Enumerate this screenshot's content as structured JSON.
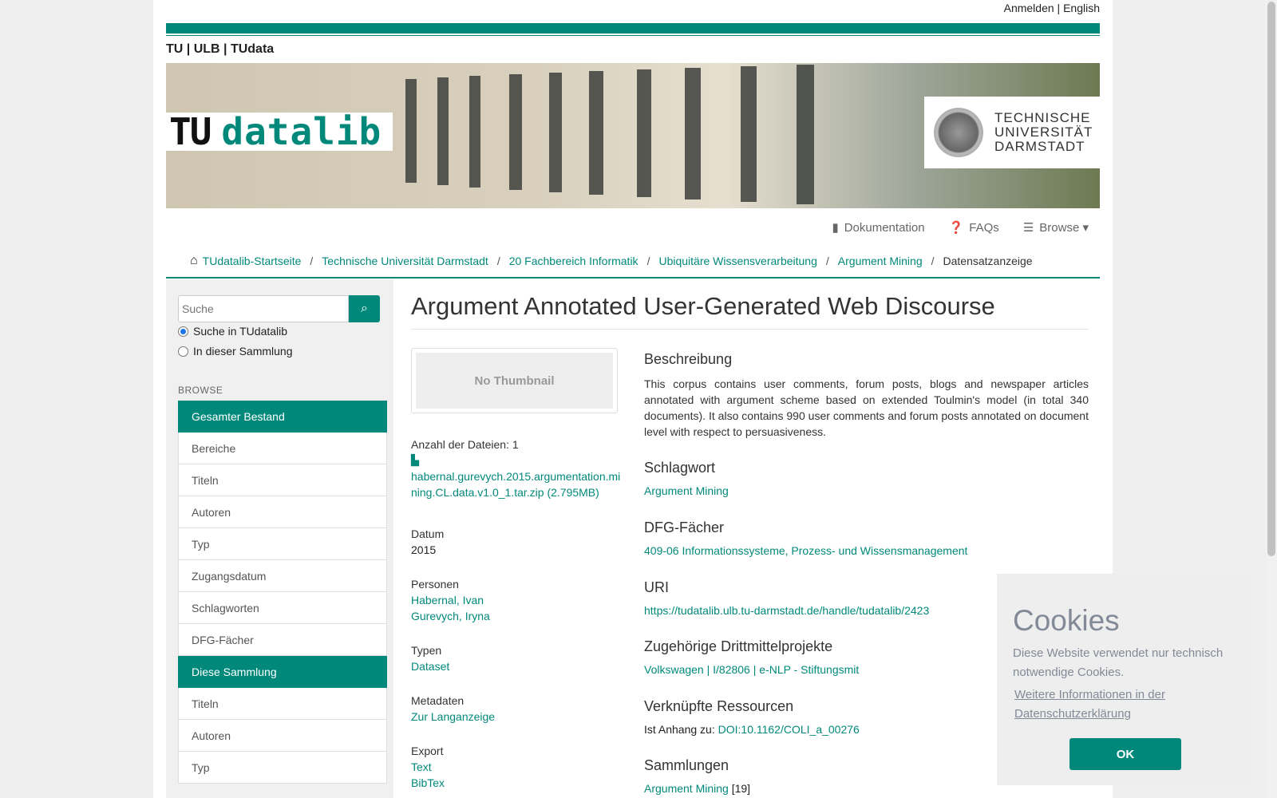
{
  "header": {
    "login": "Anmelden",
    "sep": "|",
    "language": "English",
    "brand": "TU | ULB | TUdata"
  },
  "banner": {
    "logo_tu": "TU",
    "logo_datalib": "datalib",
    "tud_line1": "TECHNISCHE",
    "tud_line2": "UNIVERSITÄT",
    "tud_line3": "DARMSTADT"
  },
  "nav": {
    "docs": "Dokumentation",
    "faqs": "FAQs",
    "browse": "Browse"
  },
  "breadcrumb": [
    "TUdatalib-Startseite",
    "Technische Universität Darmstadt",
    "20 Fachbereich Informatik",
    "Ubiquitäre Wissensverarbeitung",
    "Argument Mining",
    "Datensatzanzeige"
  ],
  "sidebar": {
    "search_placeholder": "Suche",
    "radio1": "Suche in TUdatalib",
    "radio2": "In dieser Sammlung",
    "browse_heading": "BROWSE",
    "items": [
      "Gesamter Bestand",
      "Bereiche",
      "Titeln",
      "Autoren",
      "Typ",
      "Zugangsdatum",
      "Schlagworten",
      "DFG-Fächer",
      "Diese Sammlung",
      "Titeln",
      "Autoren",
      "Typ"
    ]
  },
  "item": {
    "title": "Argument Annotated User-Generated Web Discourse",
    "no_thumbnail": "No Thumbnail",
    "files_label": "Anzahl der Dateien: 1",
    "file_link": "habernal.gurevych.2015.argumentation.mining.CL.data.v1.0_1.tar.zip (2.795MB)",
    "date_label": "Datum",
    "date_value": "2015",
    "persons_label": "Personen",
    "person1": "Habernal, Ivan",
    "person2": "Gurevych, Iryna",
    "types_label": "Typen",
    "type_value": "Dataset",
    "metadata_label": "Metadaten",
    "metadata_link": "Zur Langanzeige",
    "export_label": "Export",
    "export_text": "Text",
    "export_bibtex": "BibTex",
    "desc_heading": "Beschreibung",
    "desc_text": "This corpus contains user comments, forum posts, blogs and newspaper articles annotated with argument scheme based on extended Toulmin's model (in total 340 documents). It also contains 990 user comments and forum posts annotated on document level with respect to persuasiveness.",
    "keyword_heading": "Schlagwort",
    "keyword_value": "Argument Mining",
    "dfg_heading": "DFG-Fächer",
    "dfg_value": "409-06 Informationssysteme, Prozess- und Wissensmanagement",
    "uri_heading": "URI",
    "uri_value": "https://tudatalib.ulb.tu-darmstadt.de/handle/tudatalib/2423",
    "projects_heading": "Zugehörige Drittmittelprojekte",
    "projects_value": "Volkswagen | I/82806 | e-NLP - Stiftungsmit",
    "linked_heading": "Verknüpfte Ressourcen",
    "linked_prefix": "Ist Anhang zu:",
    "linked_value": "DOI:10.1162/COLI_a_00276",
    "collections_heading": "Sammlungen",
    "collections_value": "Argument Mining",
    "collections_count": "[19]"
  },
  "cookie": {
    "title": "Cookies",
    "text": "Diese Website verwendet nur technisch notwendige Cookies.",
    "more": "Weitere Informationen in der Datenschutzerklärung",
    "ok": "OK"
  }
}
